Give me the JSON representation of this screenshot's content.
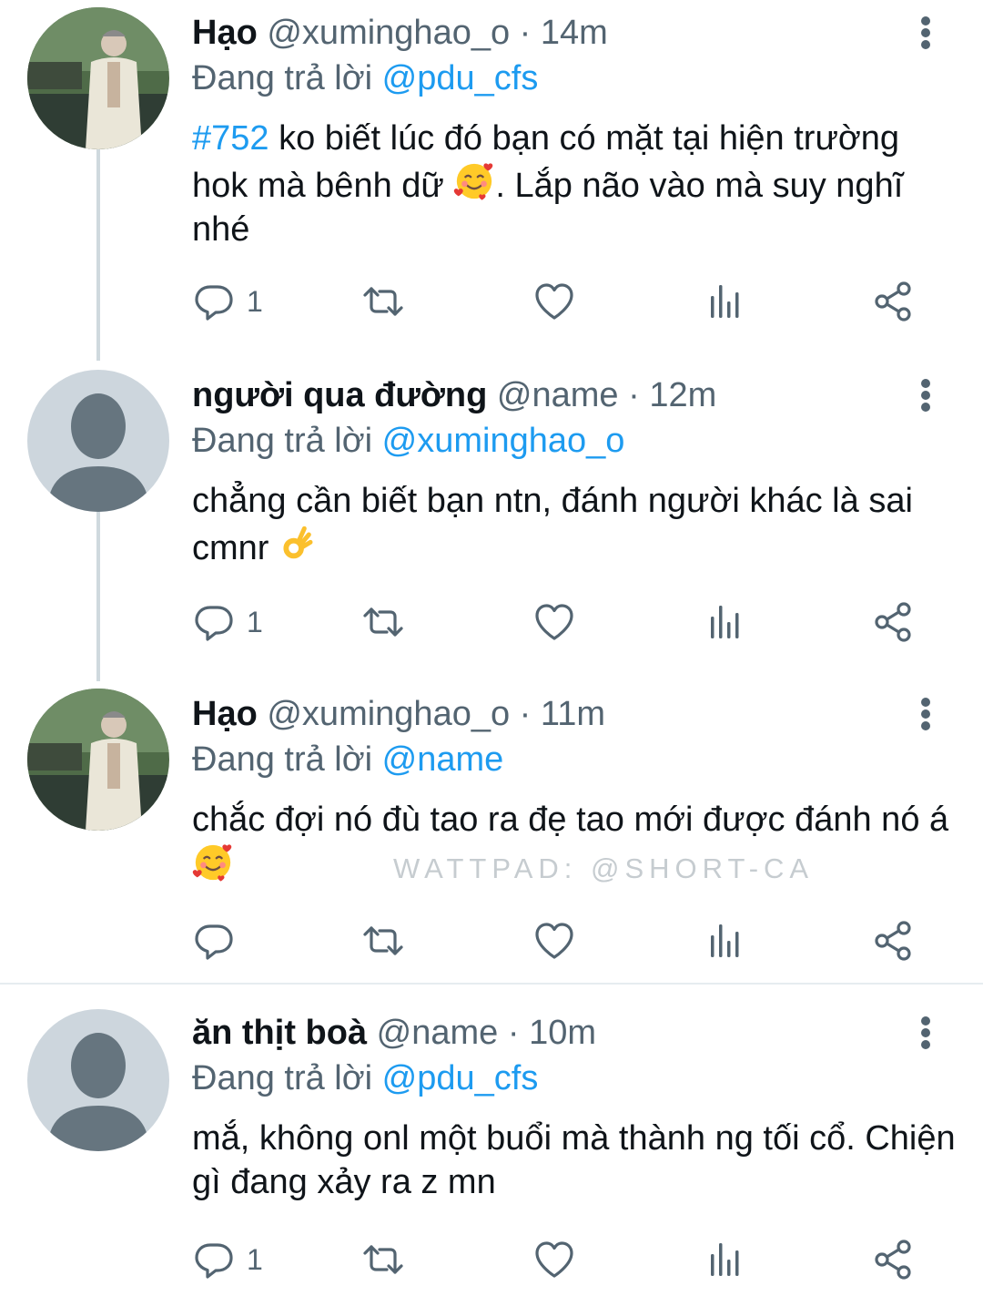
{
  "tweets": [
    {
      "name": "Hạo",
      "handle": "@xuminghao_o",
      "time": "· 14m",
      "reply_prefix": "Đang trả lời",
      "reply_to": "@pdu_cfs",
      "text_link": "#752",
      "text_a": " ko biết lúc đó bạn có mặt tại hiện trường hok mà bênh dữ ",
      "text_b": ". Lắp não vào mà suy nghĩ nhé",
      "reply_count": "1",
      "avatar": "photo-avatar"
    },
    {
      "name": "người qua đường",
      "handle": "@name",
      "time": "· 12m",
      "reply_prefix": "Đang trả lời",
      "reply_to": "@xuminghao_o",
      "text_a": "chẳng cần biết bạn ntn, đánh người khác là sai cmnr ",
      "reply_count": "1",
      "avatar": "default-avatar"
    },
    {
      "name": "Hạo",
      "handle": "@xuminghao_o",
      "time": "· 11m",
      "reply_prefix": "Đang trả lời",
      "reply_to": "@name",
      "text_a": "chắc đợi nó đù tao ra đẹ tao mới được đánh nó á ",
      "reply_count": "",
      "avatar": "photo-avatar"
    },
    {
      "name": "ăn thịt boà",
      "handle": "@name",
      "time": "· 10m",
      "reply_prefix": "Đang trả lời",
      "reply_to": "@pdu_cfs",
      "text_a": "mắ, không onl một buổi mà thành ng tối cổ. Chiện gì đang xảy ra z mn",
      "reply_count": "1",
      "avatar": "default-avatar"
    }
  ],
  "watermark": "WATTPAD: @SHORT-CA",
  "icons": [
    "reply-icon",
    "retweet-icon",
    "like-icon",
    "views-icon",
    "share-icon",
    "more-icon",
    "smiling-face-with-hearts-emoji",
    "ok-hand-emoji"
  ],
  "colors": {
    "link": "#1d9bf0",
    "secondary": "#536471",
    "divider": "#e6ecf0"
  }
}
